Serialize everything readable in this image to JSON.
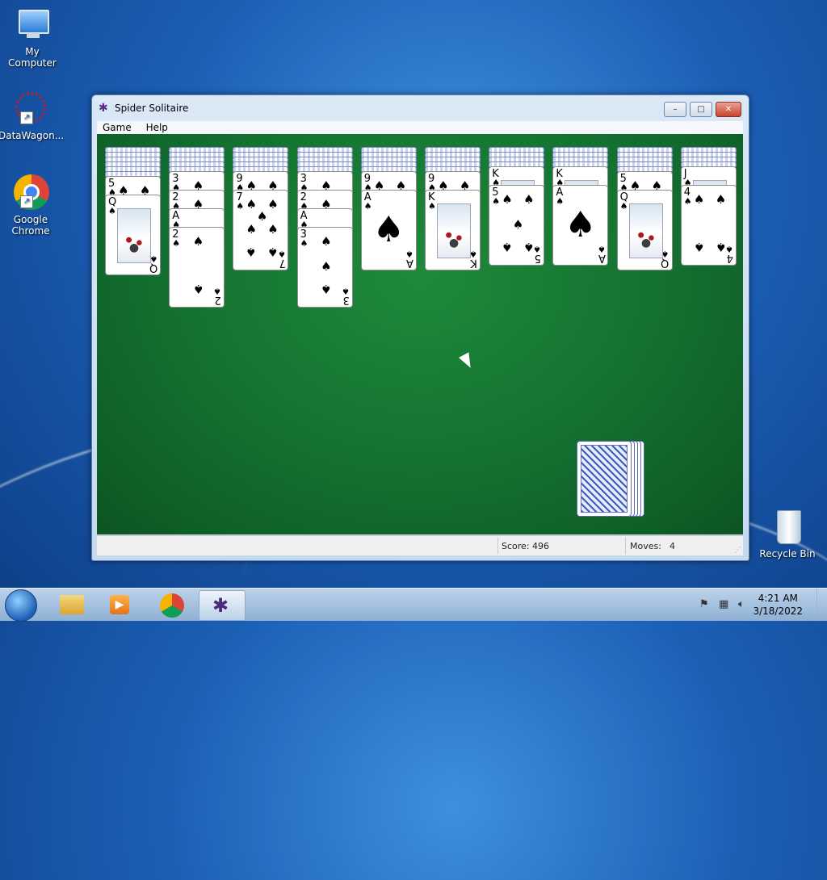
{
  "desktop": {
    "icons": [
      {
        "label": "My Computer",
        "icon": "computer-icon"
      },
      {
        "label": "DataWagon...",
        "icon": "datawagon-icon"
      },
      {
        "label": "Google Chrome",
        "icon": "chrome-icon"
      },
      {
        "label": "Recycle Bin",
        "icon": "recycle-bin-icon"
      }
    ]
  },
  "window": {
    "title": "Spider Solitaire",
    "menu": [
      "Game",
      "Help"
    ],
    "controls": {
      "minimize": "–",
      "maximize": "□",
      "close": "✕"
    }
  },
  "game": {
    "suit": "♠",
    "columns": [
      {
        "backs": 6,
        "cards": [
          "5",
          "Q"
        ]
      },
      {
        "backs": 5,
        "cards": [
          "3",
          "2",
          "A",
          "2"
        ]
      },
      {
        "backs": 5,
        "cards": [
          "9",
          "7"
        ]
      },
      {
        "backs": 5,
        "cards": [
          "3",
          "2",
          "A",
          "3"
        ]
      },
      {
        "backs": 5,
        "cards": [
          "9",
          "A"
        ]
      },
      {
        "backs": 5,
        "cards": [
          "9",
          "K"
        ]
      },
      {
        "backs": 4,
        "cards": [
          "K",
          "5"
        ]
      },
      {
        "backs": 4,
        "cards": [
          "K",
          "A"
        ]
      },
      {
        "backs": 5,
        "cards": [
          "5",
          "Q"
        ]
      },
      {
        "backs": 4,
        "cards": [
          "J",
          "4"
        ]
      }
    ],
    "stock_piles": 5
  },
  "status": {
    "score_label": "Score: 496",
    "moves_label": "Moves:",
    "moves_value": "4"
  },
  "taskbar": {
    "start": "start-orb",
    "items": [
      "explorer-icon",
      "media-player-icon",
      "chrome-icon",
      "spider-solitaire-icon"
    ],
    "time": "4:21 AM",
    "date": "3/18/2022"
  }
}
